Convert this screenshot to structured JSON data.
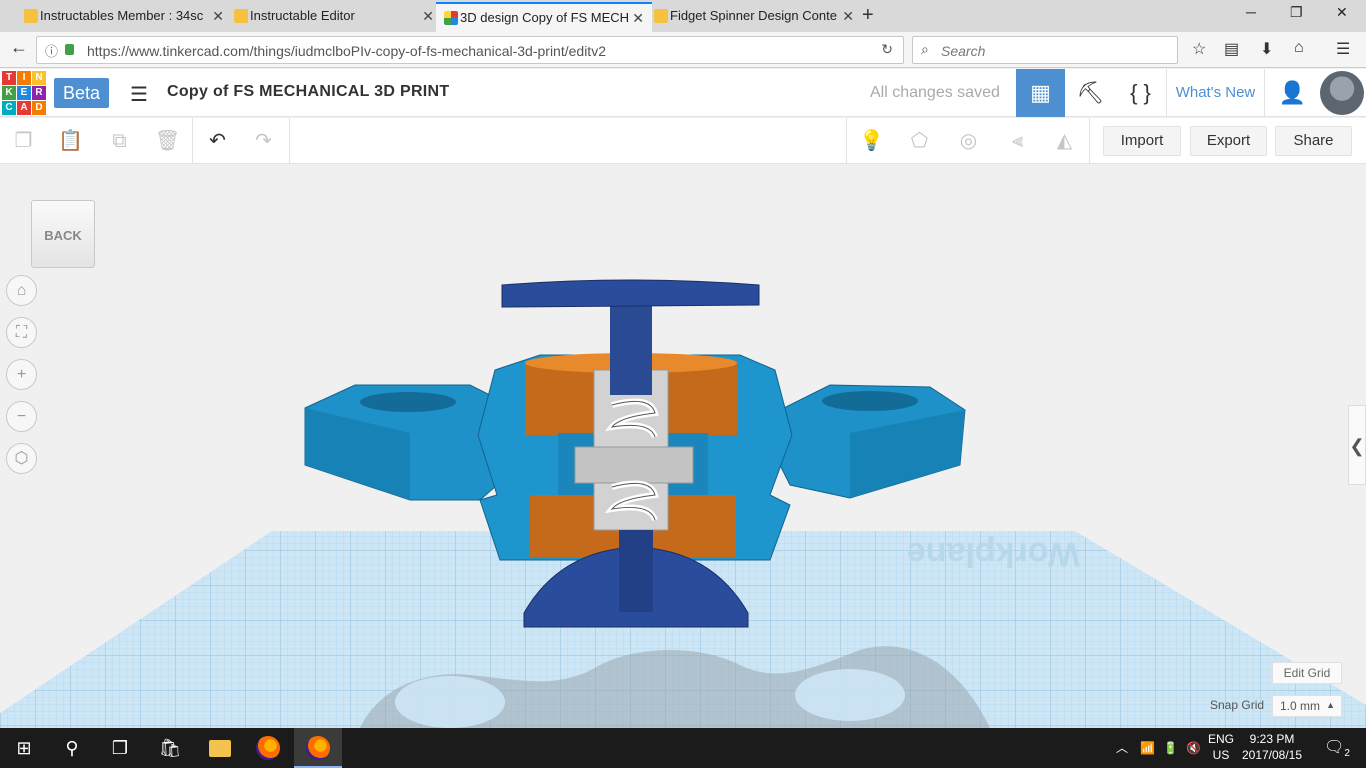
{
  "browser": {
    "tabs": [
      {
        "title": "Instructables Member : 34sc",
        "favicon": "instructables-icon"
      },
      {
        "title": "Instructable Editor",
        "favicon": "instructables-icon"
      },
      {
        "title": "3D design Copy of FS MECH",
        "favicon": "tinkercad-icon",
        "active": true
      },
      {
        "title": "Fidget Spinner Design Conte",
        "favicon": "instructables-icon"
      }
    ],
    "url": "https://www.tinkercad.com/things/iudmclboPIv-copy-of-fs-mechanical-3d-print/editv2",
    "search_placeholder": "Search"
  },
  "app": {
    "logo_letters": [
      "T",
      "I",
      "N",
      "K",
      "E",
      "R",
      "C",
      "A",
      "D"
    ],
    "logo_colors": [
      "#e53935",
      "#f57c00",
      "#fbc02d",
      "#43a047",
      "#1e88e5",
      "#8e24aa",
      "#00acc1",
      "#e53935",
      "#f57c00"
    ],
    "beta_label": "Beta",
    "design_title": "Copy of FS MECHANICAL 3D PRINT",
    "save_status": "All changes saved",
    "whats_new": "What's New",
    "accent_color": "#4d8fd1"
  },
  "toolbar": {
    "import_label": "Import",
    "export_label": "Export",
    "share_label": "Share"
  },
  "viewport": {
    "viewcube_label": "BACK",
    "workplane_label": "Workplane",
    "edit_grid_label": "Edit Grid",
    "snap_grid_label": "Snap Grid",
    "snap_grid_value": "1.0 mm"
  },
  "taskbar": {
    "lang_top": "ENG",
    "lang_bottom": "US",
    "time": "9:23 PM",
    "date": "2017/08/15",
    "notification_count": "2"
  }
}
